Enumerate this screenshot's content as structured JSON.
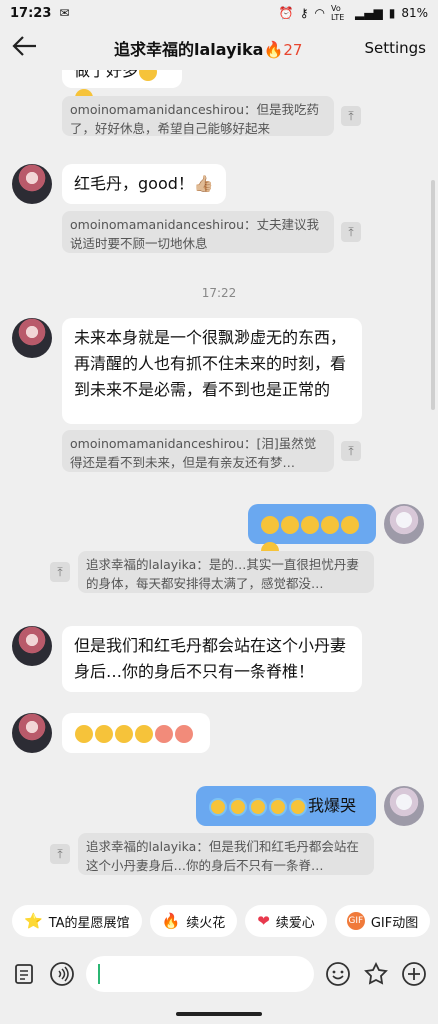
{
  "status": {
    "time": "17:23",
    "app_icon": "gmail-icon",
    "right_icons": [
      "alarm-icon",
      "key-icon",
      "wifi-icon",
      "volte-icon",
      "signal-icon"
    ],
    "volte": "Vo LTE",
    "battery": "81%"
  },
  "header": {
    "back_icon": "arrow-left-icon",
    "title": "追求幸福的lalayika",
    "fire_icon": "🔥",
    "streak": "27",
    "settings": "Settings"
  },
  "messages": {
    "top_partial": "做了好多",
    "q1": "omoinomamanidanceshirou：但是我吃药了，好好休息，希望自己能够好起来",
    "m1": "红毛丹，good！👍🏼",
    "q2": "omoinomamanidanceshirou：丈夫建议我说适时要不顾一切地休息",
    "time_1": "17:22",
    "m2": "未来本身就是一个很飘渺虚无的东西，再清醒的人也有抓不住未来的时刻，看到未来不是必需，看不到也是正常的",
    "q3": "omoinomamanidanceshirou：[泪]虽然觉得还是看不到未来，但是有亲友还有梦…",
    "q4": "追求幸福的lalayika：是的…其实一直很担忧丹妻的身体，每天都安排得太满了，感觉都没…",
    "m3": "但是我们和红毛丹都会站在这个小丹妻身后…你的身后不只有一条脊椎！",
    "me2_text": "我爆哭",
    "q5": "追求幸福的lalayika：但是我们和红毛丹都会站在这个小丹妻身后…你的身后不只有一条脊…"
  },
  "quickbar": [
    {
      "label": "TA的星愿展馆",
      "icon": "⭐"
    },
    {
      "label": "续火花",
      "icon": "🔥"
    },
    {
      "label": "续爱心",
      "icon": "❤"
    },
    {
      "label": "GIF动图",
      "icon": "GIF"
    }
  ],
  "input": {
    "placeholder": ""
  },
  "colors": {
    "accent_blue": "#6aa8f0",
    "streak_red": "#e8452e",
    "caret_green": "#2bb673"
  }
}
